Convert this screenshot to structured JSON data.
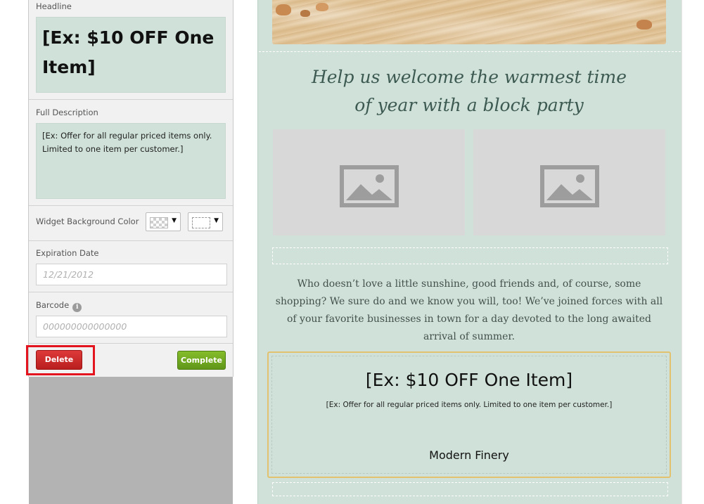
{
  "editor": {
    "headline_label": "Headline",
    "headline_value": "[Ex: $10 OFF One Item]",
    "description_label": "Full Description",
    "description_value": "[Ex: Offer for all regular priced items only. Limited to one item per customer.]",
    "bg_color_label": "Widget Background Color",
    "expiration_label": "Expiration Date",
    "expiration_placeholder": "12/21/2012",
    "barcode_label": "Barcode",
    "barcode_info": "i",
    "barcode_placeholder": "000000000000000",
    "delete_label": "Delete",
    "complete_label": "Complete",
    "caret": "▼"
  },
  "email": {
    "welcome_line1": "Help us welcome the warmest time",
    "welcome_line2": "of year with a block party",
    "body_line1": "Who doesn’t love a little sunshine, good friends and, of course, some",
    "body_line2": "shopping? We sure do and we know you will, too! We’ve joined forces with all",
    "body_line3": "of your favorite businesses in town for a day devoted to the long awaited",
    "body_line4": "arrival of summer.",
    "coupon_headline": "[Ex: $10 OFF One Item]",
    "coupon_description": "[Ex: Offer for all regular priced items only. Limited to one item per customer.]",
    "coupon_business": "Modern Finery"
  },
  "colors": {
    "email_bg": "#cfe1d8",
    "delete_red": "#c62828",
    "complete_green": "#72a822",
    "highlight_red": "#e3141d",
    "coupon_border": "#e3c26f"
  }
}
